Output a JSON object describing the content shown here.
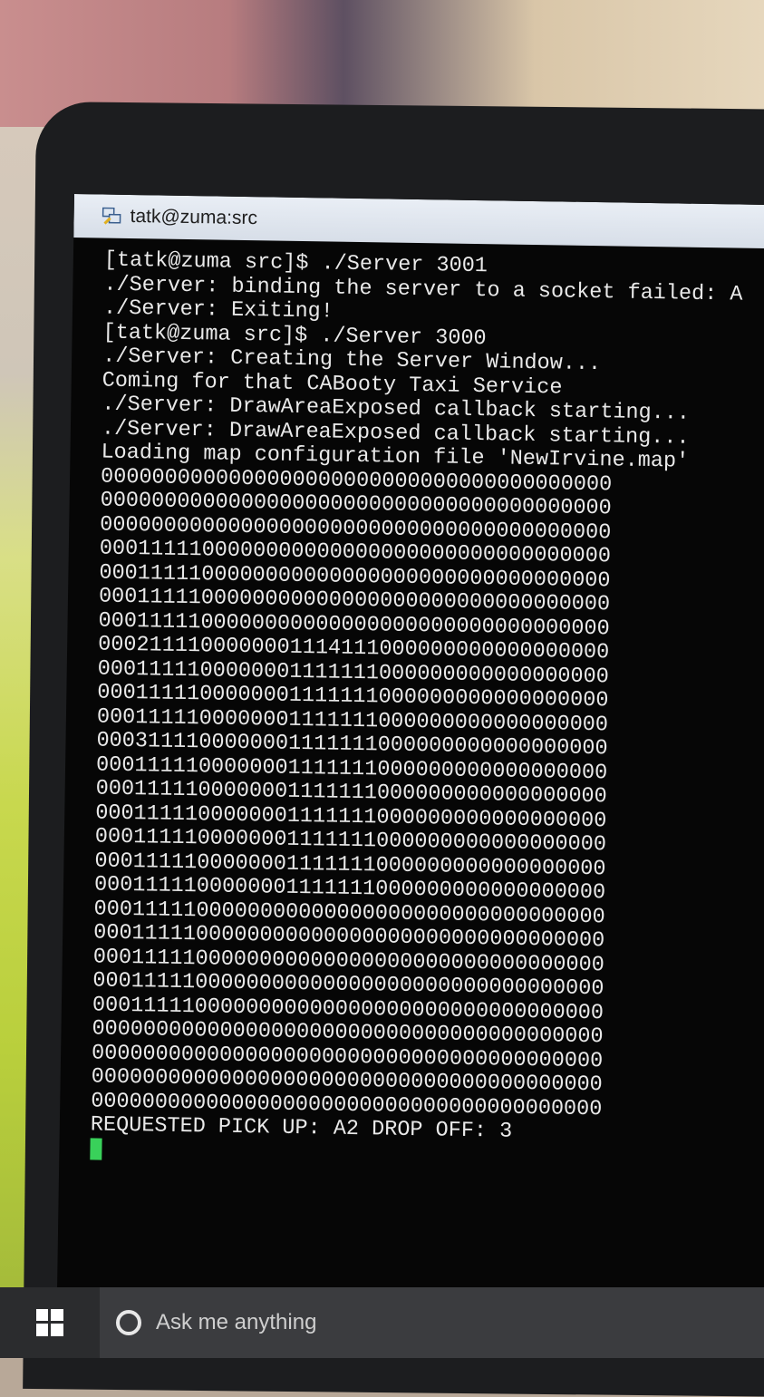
{
  "window": {
    "title": "tatk@zuma:src"
  },
  "terminal": {
    "lines": [
      "[tatk@zuma src]$ ./Server 3001",
      "./Server: binding the server to a socket failed: A",
      "./Server: Exiting!",
      "[tatk@zuma src]$ ./Server 3000",
      "./Server: Creating the Server Window...",
      "Coming for that CABooty Taxi Service",
      "./Server: DrawAreaExposed callback starting...",
      "./Server: DrawAreaExposed callback starting...",
      "Loading map configuration file 'NewIrvine.map'",
      "0000000000000000000000000000000000000000",
      "0000000000000000000000000000000000000000",
      "0000000000000000000000000000000000000000",
      "0001111100000000000000000000000000000000",
      "0001111100000000000000000000000000000000",
      "0001111100000000000000000000000000000000",
      "0001111100000000000000000000000000000000",
      "0002111100000001114111000000000000000000",
      "0001111100000001111111000000000000000000",
      "0001111100000001111111000000000000000000",
      "0001111100000001111111000000000000000000",
      "0003111100000001111111000000000000000000",
      "0001111100000001111111000000000000000000",
      "0001111100000001111111000000000000000000",
      "0001111100000001111111000000000000000000",
      "0001111100000001111111000000000000000000",
      "0001111100000001111111000000000000000000",
      "0001111100000001111111000000000000000000",
      "0001111100000000000000000000000000000000",
      "0001111100000000000000000000000000000000",
      "0001111100000000000000000000000000000000",
      "0001111100000000000000000000000000000000",
      "0001111100000000000000000000000000000000",
      "0000000000000000000000000000000000000000",
      "0000000000000000000000000000000000000000",
      "0000000000000000000000000000000000000000",
      "0000000000000000000000000000000000000000",
      "REQUESTED PICK UP: A2 DROP OFF: 3"
    ]
  },
  "taskbar": {
    "search_placeholder": "Ask me anything"
  },
  "colors": {
    "terminal_bg": "#060606",
    "terminal_text": "#e9e9e9",
    "cursor": "#39d15a",
    "taskbar": "#2b2c2e"
  }
}
